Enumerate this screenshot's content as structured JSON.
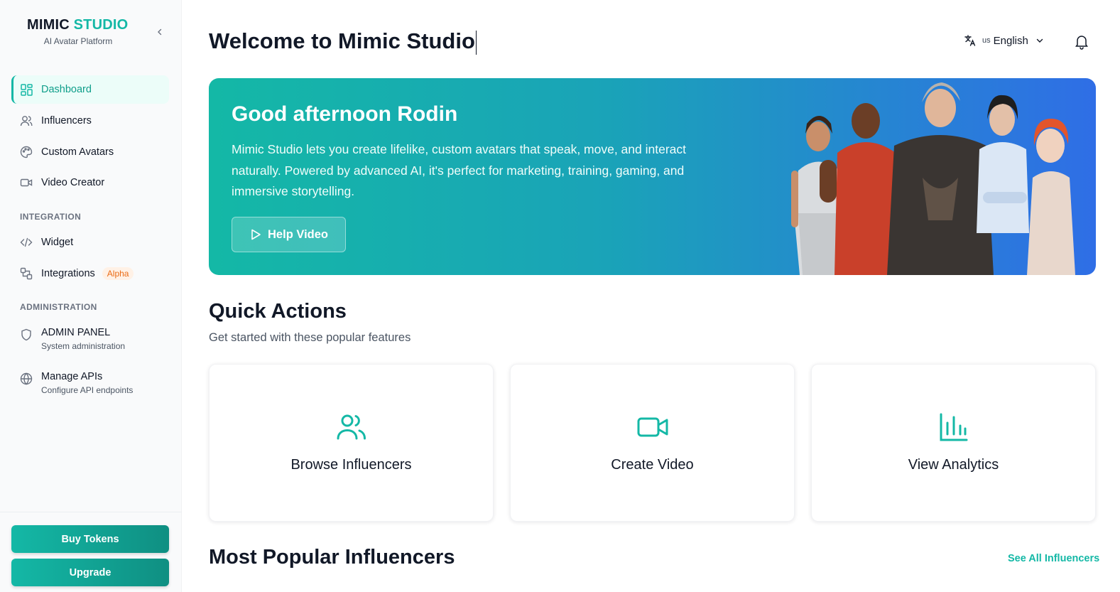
{
  "brand": {
    "title_main": "MIMIC ",
    "title_accent": "STUDIO",
    "subtitle": "AI Avatar Platform"
  },
  "sidebar": {
    "items": [
      {
        "label": "Dashboard",
        "icon": "dashboard-icon",
        "active": true
      },
      {
        "label": "Influencers",
        "icon": "users-icon"
      },
      {
        "label": "Custom Avatars",
        "icon": "palette-icon"
      },
      {
        "label": "Video Creator",
        "icon": "video-icon"
      }
    ],
    "integration_label": "INTEGRATION",
    "integration_items": [
      {
        "label": "Widget",
        "icon": "code-icon"
      },
      {
        "label": "Integrations",
        "icon": "integrations-icon",
        "badge": "Alpha"
      }
    ],
    "admin_label": "ADMINISTRATION",
    "admin_items": [
      {
        "label": "ADMIN PANEL",
        "sub": "System administration",
        "icon": "shield-icon"
      },
      {
        "label": "Manage APIs",
        "sub": "Configure API endpoints",
        "icon": "globe-icon"
      }
    ],
    "buy_tokens": "Buy Tokens",
    "upgrade": "Upgrade"
  },
  "header": {
    "title": "Welcome to Mimic Studio",
    "language_code": "us",
    "language": "English"
  },
  "hero": {
    "greeting": "Good afternoon Rodin",
    "description": "Mimic Studio lets you create lifelike, custom avatars that speak, move, and interact naturally. Powered by advanced AI, it's perfect for marketing, training, gaming, and immersive storytelling.",
    "help_button": "Help Video"
  },
  "quick_actions": {
    "title": "Quick Actions",
    "subtitle": "Get started with these popular features",
    "cards": [
      {
        "label": "Browse Influencers",
        "icon": "users-icon"
      },
      {
        "label": "Create Video",
        "icon": "video-camera-icon"
      },
      {
        "label": "View Analytics",
        "icon": "bar-chart-icon"
      }
    ]
  },
  "popular": {
    "title": "Most Popular Influencers",
    "see_all": "See All Influencers"
  },
  "colors": {
    "accent": "#14b8a6",
    "hero_start": "#14b8a6",
    "hero_end": "#2f6ee6"
  }
}
